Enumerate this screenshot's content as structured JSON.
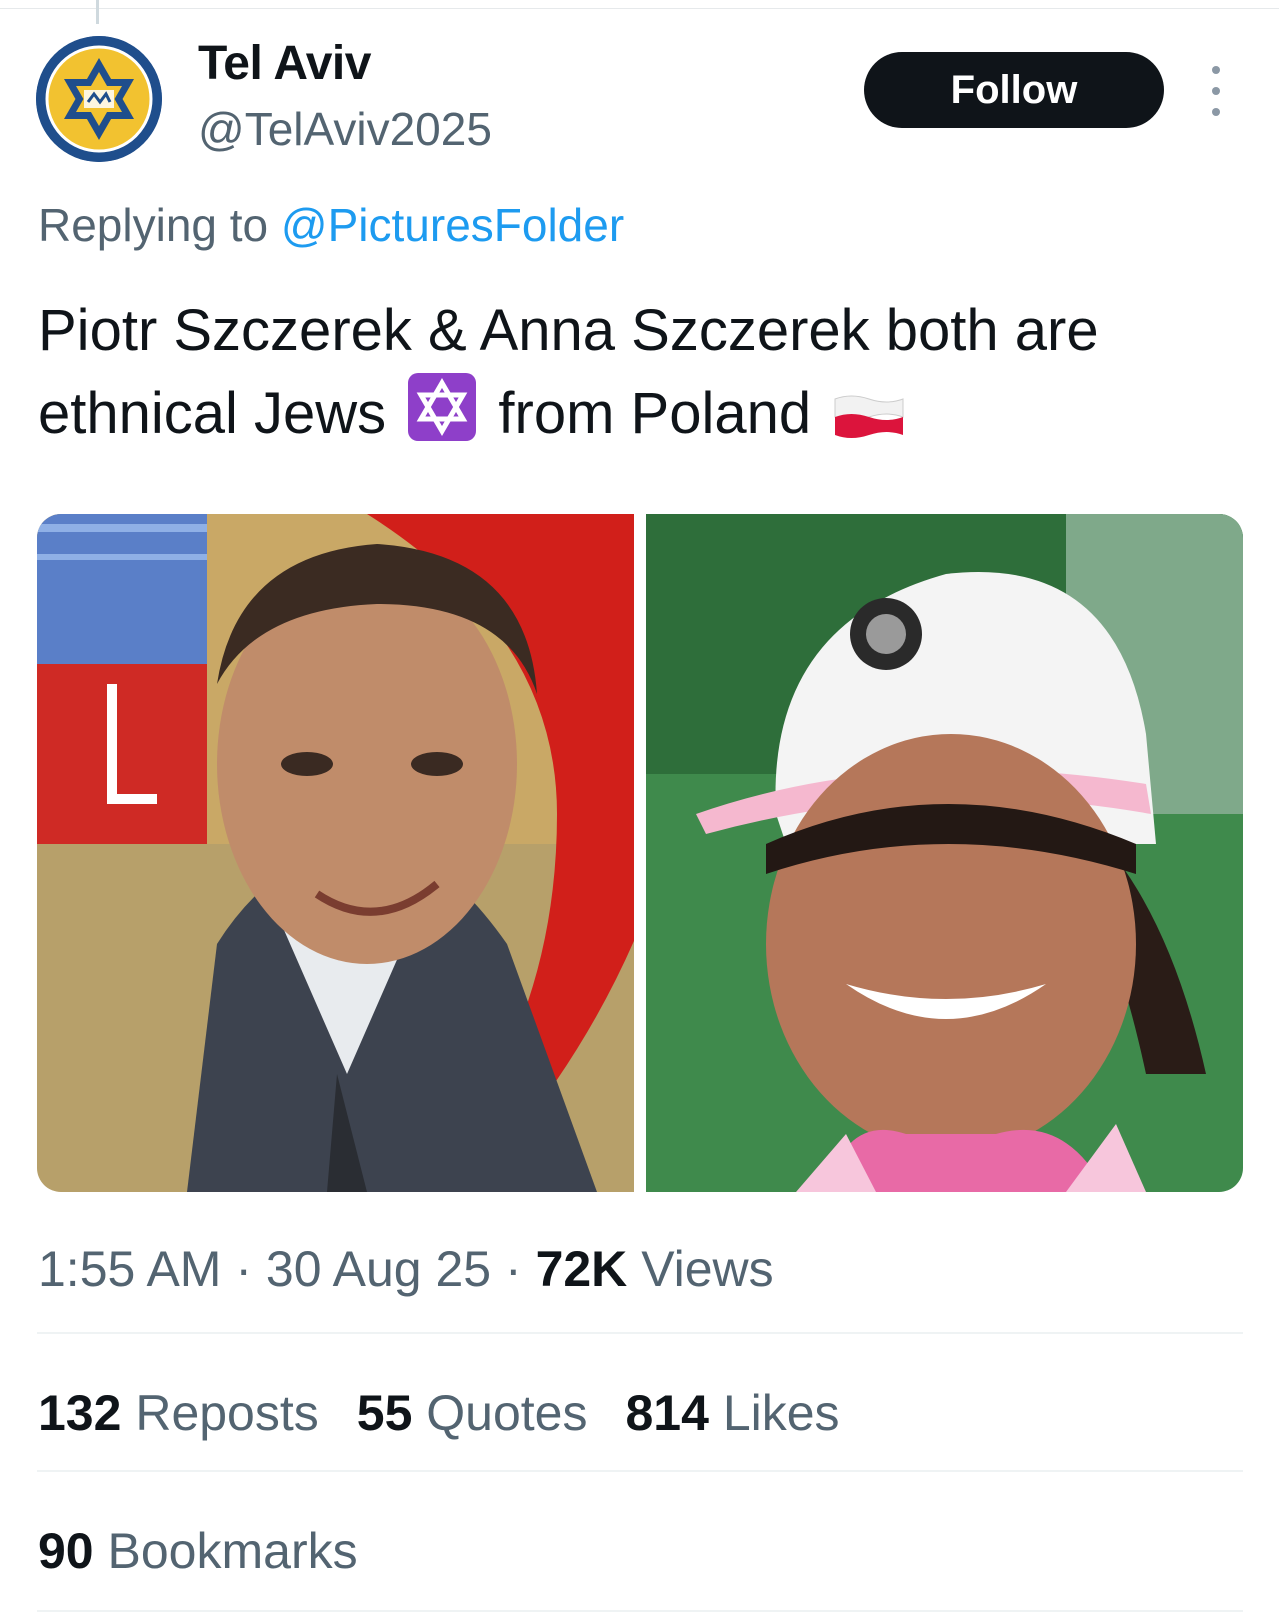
{
  "tweet": {
    "author": {
      "name": "Tel Aviv",
      "handle": "@TelAviv2025",
      "avatar_icon": "club-logo-icon"
    },
    "follow_label": "Follow",
    "more_icon": "more-vertical-icon",
    "replying_prefix": "Replying to ",
    "replying_to": "@PicturesFolder",
    "text_part1": "Piotr Szczerek & Anna Szczerek both are ethnical Jews",
    "emoji1": "star-of-david-emoji",
    "text_part2": "from Poland",
    "emoji2": "poland-flag-emoji",
    "media": [
      {
        "name": "photo-man-in-suit"
      },
      {
        "name": "photo-woman-in-cap"
      }
    ],
    "time": "1:55 AM",
    "separator": " · ",
    "date": "30 Aug 25",
    "views_count": "72K",
    "views_label": " Views",
    "reposts_count": "132",
    "reposts_label": " Reposts",
    "quotes_count": "55",
    "quotes_label": " Quotes",
    "likes_count": "814",
    "likes_label": " Likes",
    "bookmarks_count": "90",
    "bookmarks_label": " Bookmarks"
  },
  "colors": {
    "accent": "#1d9bf0",
    "text": "#0f1419",
    "secondary": "#536471",
    "follow_bg": "#0f1419"
  }
}
